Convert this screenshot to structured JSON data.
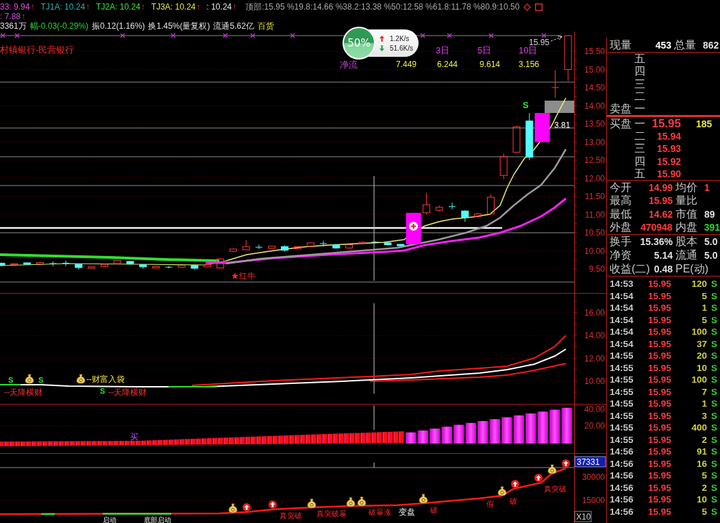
{
  "header": {
    "indicators": [
      {
        "label": "33:",
        "value": "9.94",
        "arrow": "↑",
        "color": "#e050e0"
      },
      {
        "label": "TJ1A:",
        "value": "10.24",
        "arrow": "↑",
        "color": "#30b0b0"
      },
      {
        "label": "TJ2A:",
        "value": "10.24",
        "arrow": "↑",
        "color": "#40e040"
      },
      {
        "label": "TJ3A:",
        "value": "10.24",
        "arrow": "↑",
        "color": "#e8e840"
      },
      {
        "label": ":",
        "value": "10.24",
        "arrow": "↑",
        "color": "#e8e8e8"
      }
    ],
    "levels": "顶部:15.95 %19.8:14.66 %38.2:13.38 %50:12.58 %61.8:11.78 %80.9:10.50",
    "second": {
      "label": ":",
      "value": "7.88",
      "arrow": "↑"
    },
    "stats": [
      {
        "text": "3361万",
        "kind": "plain"
      },
      {
        "text": "幅-0.03(-0.29%)",
        "kind": "down"
      },
      {
        "text": "振0.12(1.16%)",
        "kind": "plain"
      },
      {
        "text": "换1.45%(量复权)",
        "kind": "plain"
      },
      {
        "text": "流通5.62亿",
        "kind": "plain"
      },
      {
        "text": "百货",
        "kind": "sector"
      }
    ]
  },
  "network_widget": {
    "percent": "50%",
    "upload": "1.2K/s",
    "download": "51.6K/s"
  },
  "price_chart": {
    "sector": "村镇银行-民营银行",
    "net_flow": {
      "title": "净流",
      "first_value": "7.449",
      "periods": [
        {
          "label": "3日",
          "value": "6.244"
        },
        {
          "label": "5日",
          "value": "9.614"
        },
        {
          "label": "10日",
          "value": "3.156"
        }
      ]
    },
    "high_label": "15.95",
    "price_tag": "3.81",
    "signal": "S",
    "marker": "★红牛",
    "axis_labels": [
      "15.50",
      "15.00",
      "14.50",
      "14.00",
      "13.50",
      "13.00",
      "12.50",
      "12.00",
      "11.50",
      "11.00",
      "10.50",
      "10.00",
      "9.50"
    ]
  },
  "panel_1": {
    "axis_labels": [
      "16.00",
      "14.00",
      "12.00",
      "10.00"
    ],
    "signals": [
      "S",
      "S",
      "S"
    ],
    "labels": [
      {
        "text": "--天降横财",
        "kind": "drop"
      },
      {
        "text": "--财富入袋",
        "kind": "gain"
      },
      {
        "text": "--天降横财",
        "kind": "drop"
      }
    ]
  },
  "panel_2": {
    "axis_labels": [
      "40.00",
      "20.00"
    ],
    "marker": "买"
  },
  "panel_3": {
    "current_value": "37331",
    "axis_labels": [
      "30000",
      "15000"
    ],
    "scale": "X10",
    "labels": [
      {
        "text": "启动",
        "kind": "stage"
      },
      {
        "text": "底部启动",
        "kind": "stage"
      },
      {
        "text": "真突破",
        "kind": "breakout"
      },
      {
        "text": "真突破暴",
        "kind": "breakout"
      },
      {
        "text": "破暴涨",
        "kind": "breakout"
      },
      {
        "text": "变盘",
        "kind": "stage"
      },
      {
        "text": "破",
        "kind": "breakout"
      },
      {
        "text": "假",
        "kind": "breakout"
      },
      {
        "text": "破",
        "kind": "breakout"
      },
      {
        "text": "真突破",
        "kind": "breakout"
      }
    ]
  },
  "quote": {
    "now_volume": {
      "label": "现量",
      "value": "453"
    },
    "total_volume": {
      "label": "总量",
      "value": "862"
    },
    "sell_side": {
      "title": "卖盘",
      "levels": [
        "五",
        "四",
        "三",
        "二",
        "一"
      ]
    },
    "buy_side": {
      "title": "买盘",
      "levels": [
        {
          "rank": "一",
          "price": "15.95",
          "volume": "185"
        },
        {
          "rank": "二",
          "price": "15.94"
        },
        {
          "rank": "三",
          "price": "15.93"
        },
        {
          "rank": "四",
          "price": "15.92"
        },
        {
          "rank": "五",
          "price": "15.90"
        }
      ]
    },
    "stats": [
      [
        {
          "label": "今开",
          "value": "14.99",
          "kind": "up"
        },
        {
          "label": "均价",
          "value": "1",
          "kind": "up"
        }
      ],
      [
        {
          "label": "最高",
          "value": "15.95",
          "kind": "up"
        },
        {
          "label": "量比"
        }
      ],
      [
        {
          "label": "最低",
          "value": "14.62",
          "kind": "up"
        },
        {
          "label": "市值",
          "value": "89",
          "kind": "plain"
        }
      ],
      [
        {
          "label": "外盘",
          "value": "470948",
          "kind": "up"
        },
        {
          "label": "内盘",
          "value": "391",
          "kind": "down"
        }
      ]
    ],
    "finance": [
      [
        {
          "label": "换手",
          "value": "15.36%",
          "kind": "plain"
        },
        {
          "label": "股本",
          "value": "5.0",
          "kind": "plain"
        }
      ],
      [
        {
          "label": "净资",
          "value": "5.14",
          "kind": "plain"
        },
        {
          "label": "流通",
          "value": "5.0",
          "kind": "plain"
        }
      ],
      [
        {
          "label": "收益(二)",
          "value": "0.48",
          "kind": "plain"
        },
        {
          "label": "PE(动)"
        }
      ]
    ]
  },
  "trades": [
    {
      "time": "14:53",
      "price": "15.95",
      "volume": "120",
      "side": "S"
    },
    {
      "time": "14:54",
      "price": "15.95",
      "volume": "5",
      "side": "S"
    },
    {
      "time": "14:54",
      "price": "15.95",
      "volume": "1",
      "side": "S"
    },
    {
      "time": "14:54",
      "price": "15.95",
      "volume": "5",
      "side": "S"
    },
    {
      "time": "14:54",
      "price": "15.95",
      "volume": "100",
      "side": "S"
    },
    {
      "time": "14:54",
      "price": "15.95",
      "volume": "37",
      "side": "S"
    },
    {
      "time": "14:55",
      "price": "15.95",
      "volume": "20",
      "side": "S"
    },
    {
      "time": "14:55",
      "price": "15.95",
      "volume": "10",
      "side": "S"
    },
    {
      "time": "14:55",
      "price": "15.95",
      "volume": "100",
      "side": "S"
    },
    {
      "time": "14:55",
      "price": "15.95",
      "volume": "7",
      "side": "S"
    },
    {
      "time": "14:55",
      "price": "15.95",
      "volume": "1",
      "side": "S"
    },
    {
      "time": "14:55",
      "price": "15.95",
      "volume": "3",
      "side": "S"
    },
    {
      "time": "14:55",
      "price": "15.95",
      "volume": "400",
      "side": "S"
    },
    {
      "time": "14:55",
      "price": "15.95",
      "volume": "2",
      "side": "S"
    },
    {
      "time": "14:56",
      "price": "15.95",
      "volume": "91",
      "side": "S"
    },
    {
      "time": "14:56",
      "price": "15.95",
      "volume": "16",
      "side": "S"
    },
    {
      "time": "14:56",
      "price": "15.95",
      "volume": "5",
      "side": "S"
    },
    {
      "time": "14:56",
      "price": "15.95",
      "volume": "2",
      "side": "S"
    },
    {
      "time": "14:56",
      "price": "15.95",
      "volume": "10",
      "side": "S"
    },
    {
      "time": "14:56",
      "price": "15.95",
      "volume": "5",
      "side": "S"
    }
  ]
}
